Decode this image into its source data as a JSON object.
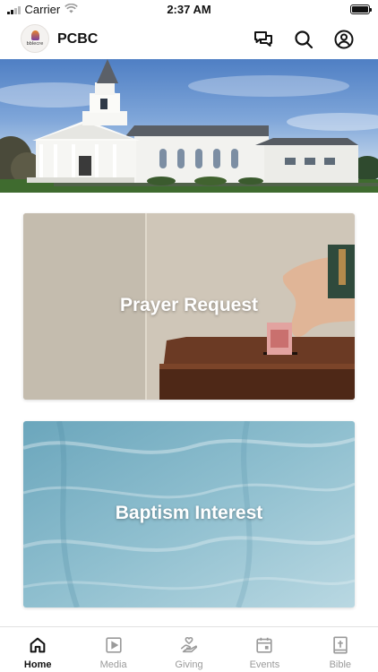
{
  "status_bar": {
    "carrier": "Carrier",
    "time": "2:37 AM"
  },
  "header": {
    "logo_text": "bblecre",
    "title": "PCBC",
    "icons": [
      "chat-icon",
      "search-icon",
      "profile-icon"
    ]
  },
  "cards": [
    {
      "title": "Prayer Request"
    },
    {
      "title": "Baptism Interest"
    }
  ],
  "tabs": [
    {
      "label": "Home",
      "icon": "home-icon",
      "active": true
    },
    {
      "label": "Media",
      "icon": "media-icon",
      "active": false
    },
    {
      "label": "Giving",
      "icon": "giving-icon",
      "active": false
    },
    {
      "label": "Events",
      "icon": "events-icon",
      "active": false
    },
    {
      "label": "Bible",
      "icon": "bible-icon",
      "active": false
    }
  ],
  "colors": {
    "active_tab": "#111111",
    "inactive_tab": "#9a9a9a",
    "card_title": "#ffffff"
  }
}
